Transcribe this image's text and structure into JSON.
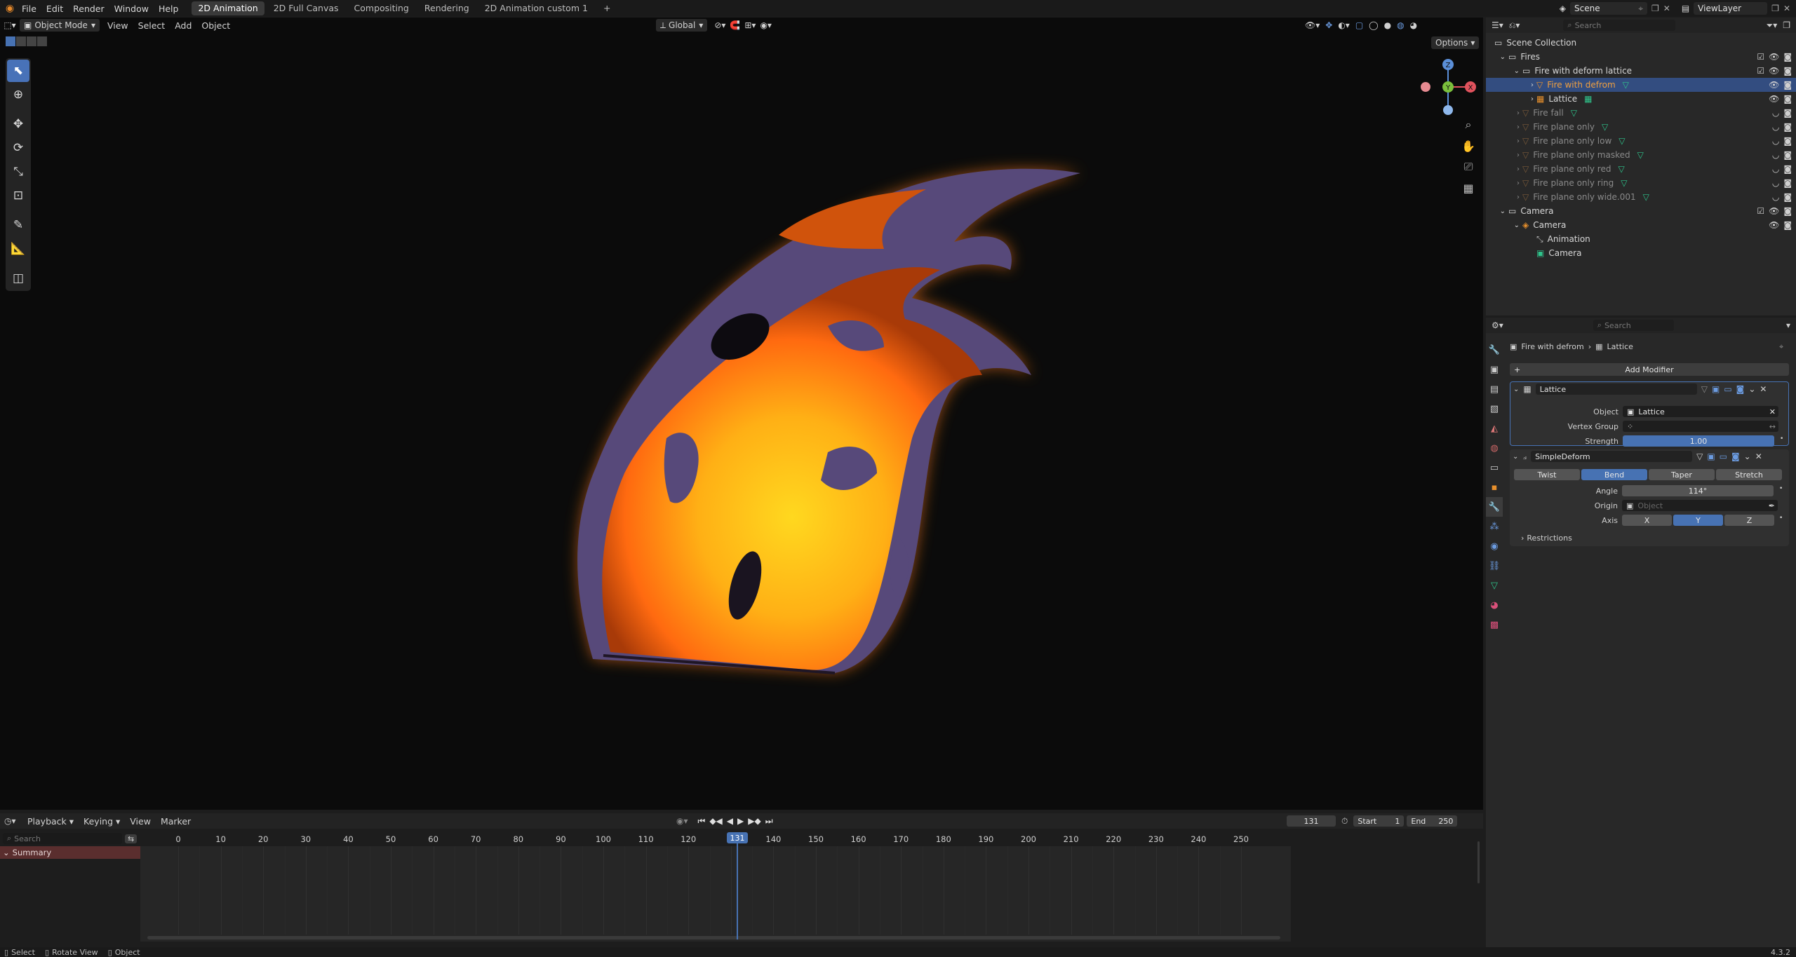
{
  "topbar": {
    "menus": [
      "File",
      "Edit",
      "Render",
      "Window",
      "Help"
    ],
    "workspaces": [
      "2D Animation",
      "2D Full Canvas",
      "Compositing",
      "Rendering",
      "2D Animation custom 1"
    ],
    "active_workspace": "2D Animation",
    "add_tab": "+",
    "scene": "Scene",
    "view_layer": "ViewLayer"
  },
  "viewport": {
    "mode": "Object Mode",
    "menus": [
      "View",
      "Select",
      "Add",
      "Object"
    ],
    "transform_orientation": "Global",
    "options": "Options",
    "gizmo": {
      "z": "Z",
      "y": "Y",
      "x": "X"
    }
  },
  "outliner": {
    "search_placeholder": "Search",
    "rows": [
      {
        "label": "Scene Collection",
        "indent": 0,
        "type": "collection",
        "state": "normal"
      },
      {
        "label": "Fires",
        "indent": 1,
        "type": "collection",
        "state": "normal"
      },
      {
        "label": "Fire with deform lattice",
        "indent": 2,
        "type": "collection",
        "state": "normal"
      },
      {
        "label": "Fire with defrom",
        "indent": 3,
        "type": "object",
        "state": "selected"
      },
      {
        "label": "Lattice",
        "indent": 3,
        "type": "lattice",
        "state": "normal"
      },
      {
        "label": "Fire fall",
        "indent": 2,
        "type": "object",
        "state": "dim"
      },
      {
        "label": "Fire plane only",
        "indent": 2,
        "type": "object",
        "state": "dim"
      },
      {
        "label": "Fire plane only low",
        "indent": 2,
        "type": "object",
        "state": "dim"
      },
      {
        "label": "Fire plane only masked",
        "indent": 2,
        "type": "object",
        "state": "dim"
      },
      {
        "label": "Fire plane only red",
        "indent": 2,
        "type": "object",
        "state": "dim"
      },
      {
        "label": "Fire plane only ring",
        "indent": 2,
        "type": "object",
        "state": "dim"
      },
      {
        "label": "Fire plane only wide.001",
        "indent": 2,
        "type": "object",
        "state": "dim"
      },
      {
        "label": "Camera",
        "indent": 1,
        "type": "collection",
        "state": "normal"
      },
      {
        "label": "Camera",
        "indent": 2,
        "type": "camera",
        "state": "normal"
      },
      {
        "label": "Animation",
        "indent": 3,
        "type": "action",
        "state": "normal"
      },
      {
        "label": "Camera",
        "indent": 3,
        "type": "camera-data",
        "state": "normal"
      }
    ]
  },
  "properties": {
    "search_placeholder": "Search",
    "breadcrumb": [
      "Fire with defrom",
      "Lattice"
    ],
    "add_modifier": "Add Modifier",
    "lattice_modifier": {
      "name": "Lattice",
      "object_label": "Object",
      "object_value": "Lattice",
      "vertex_group_label": "Vertex Group",
      "strength_label": "Strength",
      "strength_value": "1.00"
    },
    "simpledeform_modifier": {
      "name": "SimpleDeform",
      "modes": [
        "Twist",
        "Bend",
        "Taper",
        "Stretch"
      ],
      "active_mode": "Bend",
      "angle_label": "Angle",
      "angle_value": "114°",
      "origin_label": "Origin",
      "origin_placeholder": "Object",
      "axis_label": "Axis",
      "axes": [
        "X",
        "Y",
        "Z"
      ],
      "active_axis": "Y",
      "restrictions": "Restrictions"
    }
  },
  "timeline": {
    "menus": [
      "Playback",
      "Keying",
      "View",
      "Marker"
    ],
    "current_frame": "131",
    "start_label": "Start",
    "start_value": "1",
    "end_label": "End",
    "end_value": "250",
    "search_placeholder": "Search",
    "summary": "Summary",
    "ticks": [
      "0",
      "10",
      "20",
      "30",
      "40",
      "50",
      "60",
      "70",
      "80",
      "90",
      "100",
      "110",
      "120",
      "140",
      "150",
      "160",
      "170",
      "180",
      "190",
      "200",
      "210",
      "220",
      "230",
      "240",
      "250"
    ],
    "playhead_label": "131"
  },
  "statusbar": {
    "items": [
      "Select",
      "Rotate View",
      "Object"
    ],
    "version": "4.3.2"
  },
  "colors": {
    "accent": "#4772b3",
    "selected_row": "#334d80",
    "viewport_bg": "#0b0b0b",
    "flame_core": "#ffd21a",
    "flame_mid": "#ff8a12",
    "flame_edge": "#5a4d78"
  }
}
